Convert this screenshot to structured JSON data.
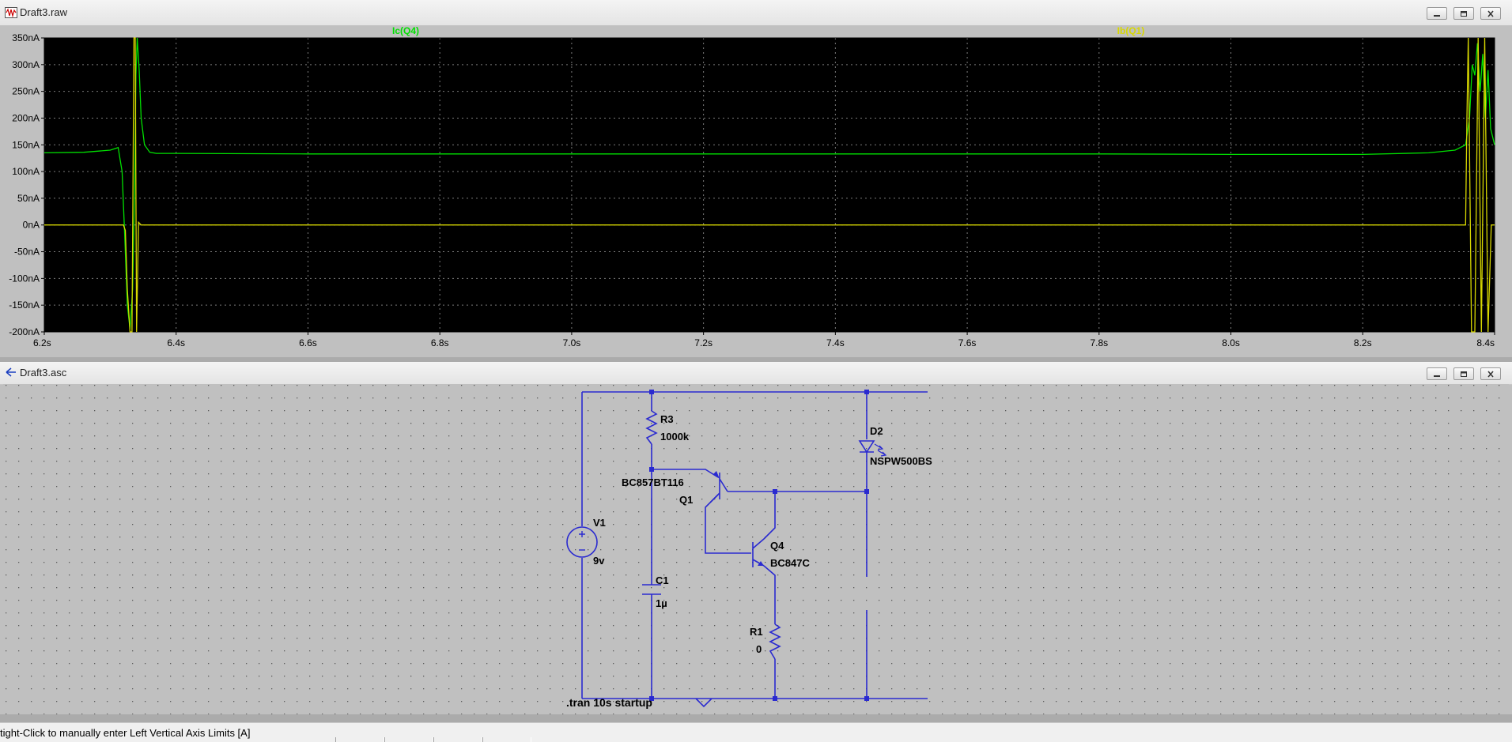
{
  "waveform_window": {
    "title": "Draft3.raw",
    "icon": "waveform-viewer-icon",
    "trace_labels": [
      {
        "name": "Ic(Q4)",
        "color": "#00e000"
      },
      {
        "name": "Ib(Q1)",
        "color": "#d8d800"
      }
    ],
    "y_ticks": [
      "350nA",
      "300nA",
      "250nA",
      "200nA",
      "150nA",
      "100nA",
      "50nA",
      "0nA",
      "-50nA",
      "-100nA",
      "-150nA",
      "-200nA"
    ],
    "x_ticks": [
      "6.2s",
      "6.4s",
      "6.6s",
      "6.8s",
      "7.0s",
      "7.2s",
      "7.4s",
      "7.6s",
      "7.8s",
      "8.0s",
      "8.2s",
      "8.4s"
    ]
  },
  "chart_data": {
    "type": "line",
    "title": "",
    "xlabel": "",
    "ylabel": "",
    "xlim": [
      6.2,
      8.4
    ],
    "ylim": [
      -200,
      350
    ],
    "x_unit": "s",
    "y_unit": "nA",
    "grid": true,
    "background": "#000000",
    "series": [
      {
        "name": "Ic(Q4)",
        "color": "#00e000",
        "x": [
          6.2,
          6.26,
          6.3,
          6.312,
          6.318,
          6.322,
          6.326,
          6.33,
          6.334,
          6.337,
          6.339,
          6.341,
          6.344,
          6.347,
          6.352,
          6.36,
          6.37,
          6.4,
          6.6,
          6.8,
          7.0,
          7.2,
          7.4,
          7.6,
          7.8,
          8.0,
          8.2,
          8.3,
          8.34,
          8.356,
          8.362,
          8.366,
          8.37,
          8.374,
          8.378,
          8.382,
          8.386,
          8.39,
          8.394,
          8.4
        ],
        "y": [
          135,
          136,
          140,
          145,
          100,
          -20,
          -150,
          -195,
          -120,
          60,
          280,
          350,
          290,
          200,
          150,
          136,
          134,
          134,
          133,
          133,
          133,
          133,
          133,
          133,
          133,
          132,
          132,
          135,
          140,
          150,
          200,
          300,
          280,
          340,
          250,
          320,
          200,
          290,
          180,
          150
        ]
      },
      {
        "name": "Ib(Q1)",
        "color": "#d8d800",
        "x": [
          6.2,
          6.32,
          6.323,
          6.326,
          6.33,
          6.333,
          6.336,
          6.338,
          6.34,
          6.343,
          6.347,
          6.36,
          6.6,
          7.0,
          7.4,
          7.8,
          8.2,
          8.356,
          8.358,
          8.36,
          8.365,
          8.37,
          8.375,
          8.38,
          8.385,
          8.39,
          8.395,
          8.4
        ],
        "y": [
          0,
          0,
          -10,
          -120,
          -200,
          -200,
          350,
          350,
          -200,
          5,
          0,
          0,
          0,
          0,
          0,
          0,
          0,
          0,
          200,
          350,
          -200,
          -200,
          350,
          -200,
          350,
          -200,
          0,
          0
        ]
      }
    ]
  },
  "schematic_window": {
    "title": "Draft3.asc",
    "icon": "schematic-editor-icon",
    "components": {
      "R3": {
        "ref": "R3",
        "value": "1000k"
      },
      "D2": {
        "ref": "D2",
        "value": "NSPW500BS"
      },
      "Q1": {
        "ref": "Q1",
        "value": "BC857BT116"
      },
      "V1": {
        "ref": "V1",
        "value": "9v"
      },
      "Q4": {
        "ref": "Q4",
        "value": "BC847C"
      },
      "C1": {
        "ref": "C1",
        "value": "1µ"
      },
      "R1": {
        "ref": "R1",
        "value": "0"
      }
    },
    "directive": ".tran 10s startup",
    "wire_color": "#2a2ad0",
    "grid_dot_color": "#5a5a5a"
  },
  "status_bar": {
    "text": "tight-Click to manually enter Left Vertical Axis Limits [A]"
  }
}
